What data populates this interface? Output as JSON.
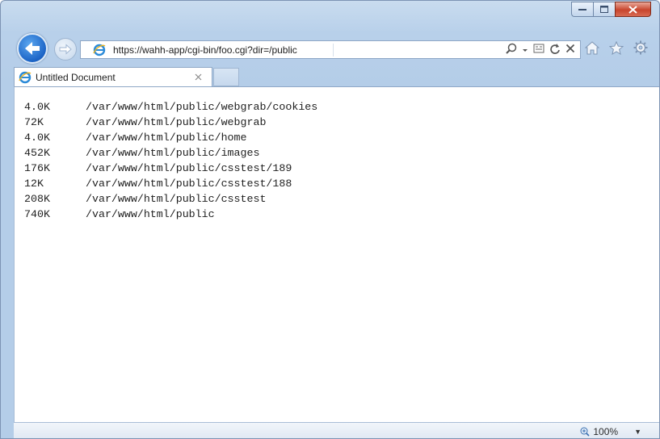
{
  "browser": {
    "url": "https://wahh-app/cgi-bin/foo.cgi?dir=/public",
    "tab_title": "Untitled Document",
    "zoom": "100%"
  },
  "listing": [
    {
      "size": "4.0K",
      "path": "/var/www/html/public/webgrab/cookies"
    },
    {
      "size": "72K",
      "path": "/var/www/html/public/webgrab"
    },
    {
      "size": "4.0K",
      "path": "/var/www/html/public/home"
    },
    {
      "size": "452K",
      "path": "/var/www/html/public/images"
    },
    {
      "size": "176K",
      "path": "/var/www/html/public/csstest/189"
    },
    {
      "size": "12K",
      "path": "/var/www/html/public/csstest/188"
    },
    {
      "size": "208K",
      "path": "/var/www/html/public/csstest"
    },
    {
      "size": "740K",
      "path": "/var/www/html/public"
    }
  ],
  "icons": {
    "back": "back-arrow-icon",
    "forward": "forward-arrow-icon",
    "ie": "internet-explorer-icon",
    "search": "search-icon",
    "compat": "compatibility-view-icon",
    "refresh": "refresh-icon",
    "stop": "stop-icon",
    "home": "home-icon",
    "favorites": "favorites-star-icon",
    "tools": "gear-icon",
    "zoom": "zoom-icon"
  },
  "colors": {
    "frame": "#b8d0ea",
    "back_button": "#1c64c6",
    "close_button": "#c8452d"
  }
}
